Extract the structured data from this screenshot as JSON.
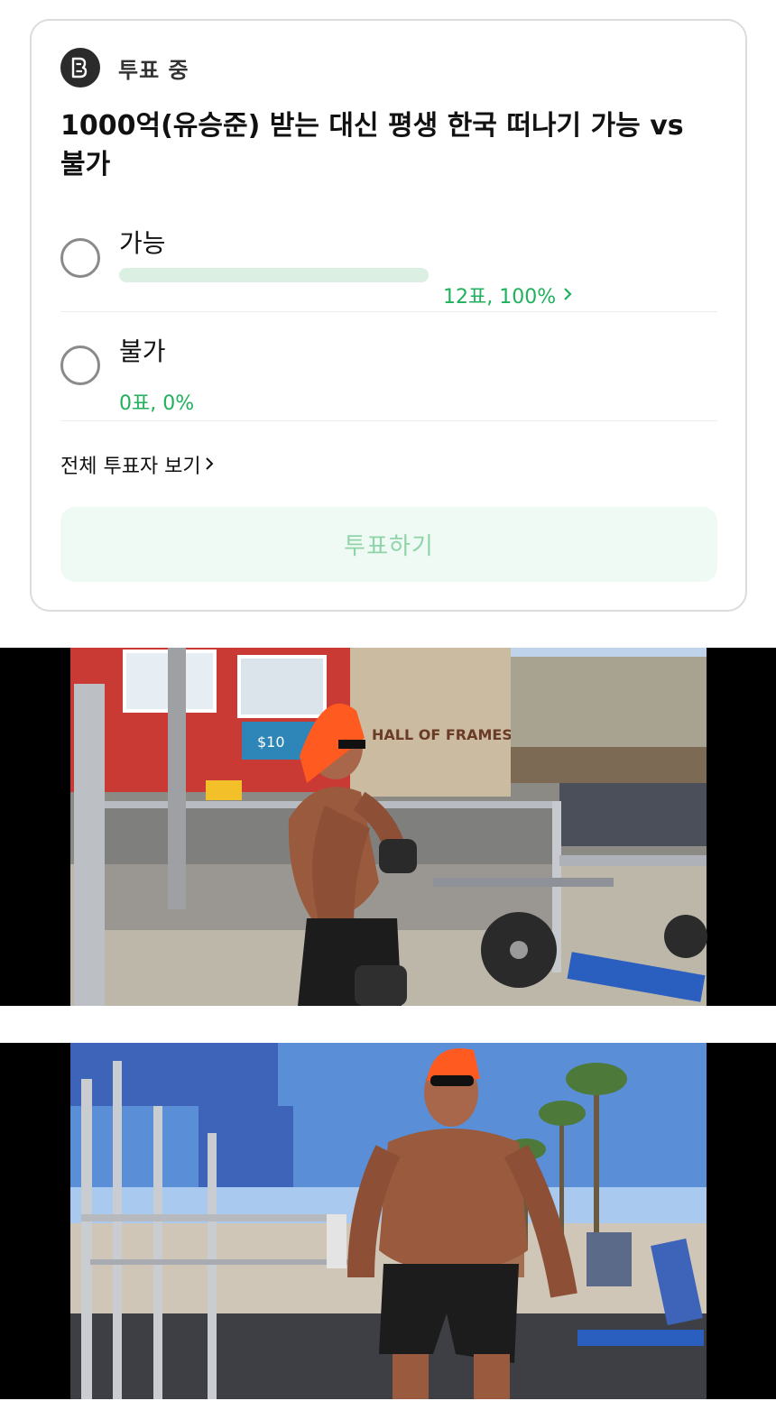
{
  "poll": {
    "status": "투표 중",
    "question": "1000억(유승준) 받는 대신 평생 한국 떠나기 가능 vs 불가",
    "options": [
      {
        "label": "가능",
        "result": "12표, 100%",
        "percent": 100
      },
      {
        "label": "불가",
        "result": "0표, 0%",
        "percent": 0
      }
    ],
    "view_all_voters": "전체 투표자 보기",
    "vote_button": "투표하기"
  },
  "media": {
    "photo1": {
      "sign_text": "HALL OF FRAMES",
      "store_sign": "$10"
    },
    "photo2": {}
  },
  "colors": {
    "accent_green": "#1fb15c",
    "bar_fill": "#dcefe3",
    "button_bg": "#f0faf4",
    "button_text": "#8fd4a8",
    "border": "#dcdcdc"
  },
  "icons": [
    "poll-app-icon",
    "radio-icon",
    "chevron-right-icon"
  ]
}
